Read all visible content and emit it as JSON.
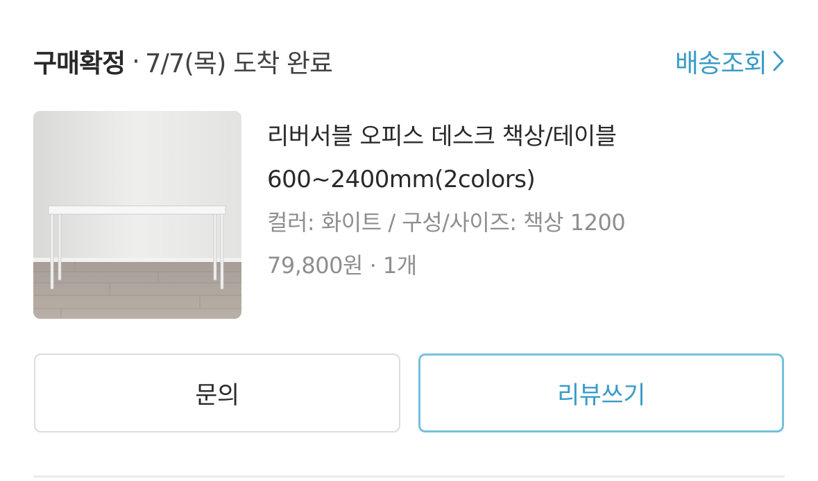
{
  "order": {
    "status": "구매확정",
    "separator": "·",
    "arrival": "7/7(목) 도착 완료",
    "track_label": "배송조회"
  },
  "product": {
    "name_line1": "리버서블 오피스 데스크 책상/테이블",
    "name_line2": "600~2400mm(2colors)",
    "option": "컬러: 화이트 / 구성/사이즈: 책상 1200",
    "price": "79,800원 · 1개"
  },
  "actions": {
    "inquiry_label": "문의",
    "review_label": "리뷰쓰기"
  },
  "colors": {
    "accent": "#3a9bc7",
    "accent_border": "#74c0dd"
  }
}
